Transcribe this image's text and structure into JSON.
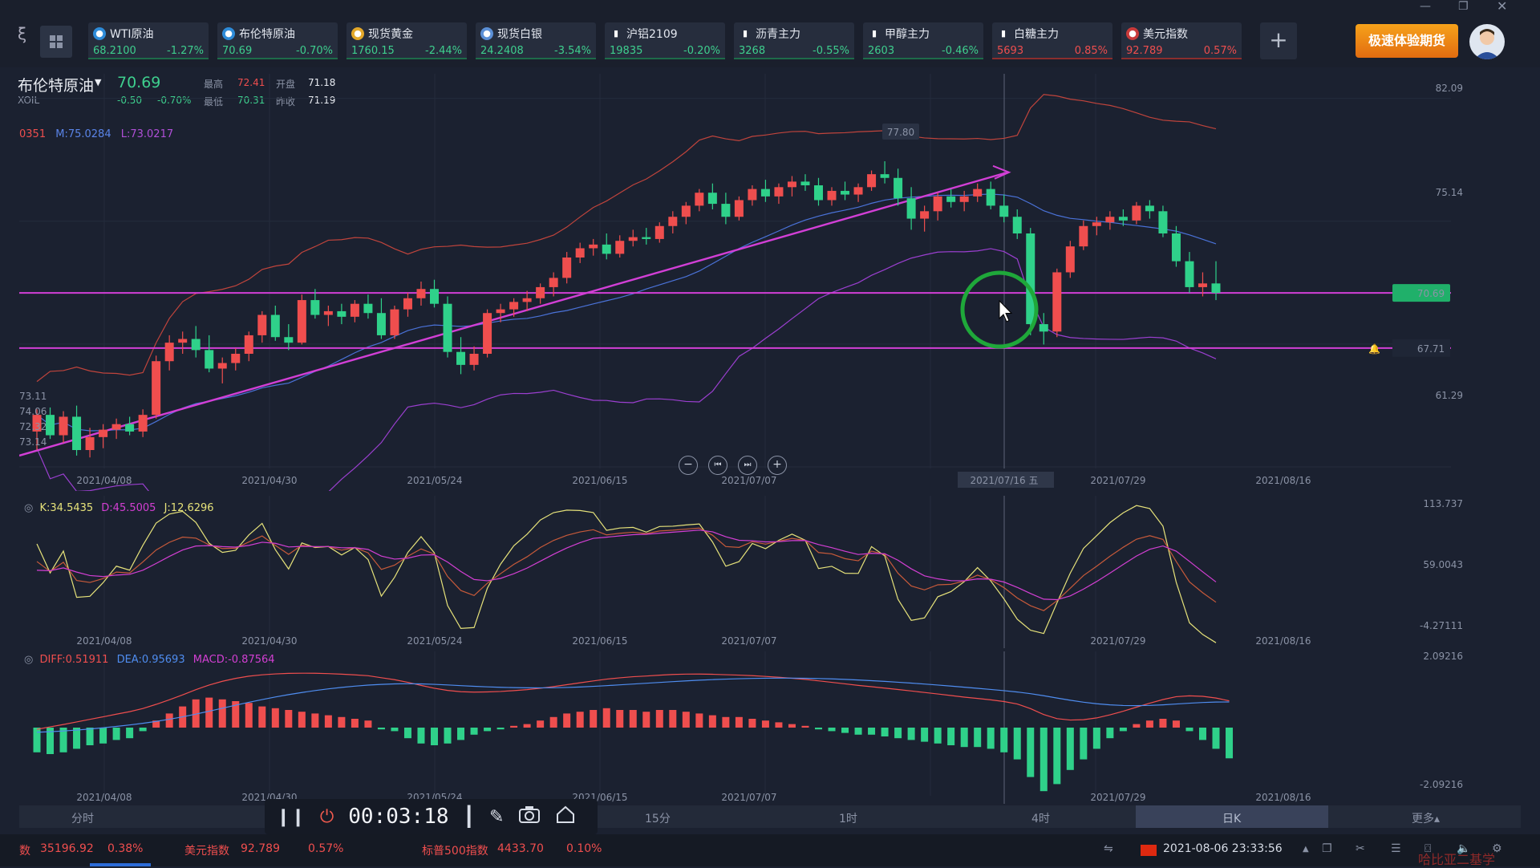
{
  "tickers": [
    {
      "name": "WTI原油",
      "price": "68.2100",
      "change": "-1.27%",
      "dir": "down",
      "icon": "oil-icon"
    },
    {
      "name": "布伦特原油",
      "price": "70.69",
      "change": "-0.70%",
      "dir": "down",
      "icon": "oil-icon"
    },
    {
      "name": "现货黄金",
      "price": "1760.15",
      "change": "-2.44%",
      "dir": "down",
      "icon": "gold-icon"
    },
    {
      "name": "现货白银",
      "price": "24.2408",
      "change": "-3.54%",
      "dir": "down",
      "icon": "silver-icon"
    },
    {
      "name": "沪铝2109",
      "price": "19835",
      "change": "-0.20%",
      "dir": "down",
      "icon": "bar-chart-icon"
    },
    {
      "name": "沥青主力",
      "price": "3268",
      "change": "-0.55%",
      "dir": "down",
      "icon": "bar-chart-icon"
    },
    {
      "name": "甲醇主力",
      "price": "2603",
      "change": "-0.46%",
      "dir": "down",
      "icon": "bar-chart-icon"
    },
    {
      "name": "白糖主力",
      "price": "5693",
      "change": "0.85%",
      "dir": "up",
      "icon": "bar-chart-icon"
    },
    {
      "name": "美元指数",
      "price": "92.789",
      "change": "0.57%",
      "dir": "up",
      "icon": "us-flag-icon"
    }
  ],
  "promo_label": "极速体验期货",
  "instrument": {
    "name": "布伦特原油",
    "code": "XOIL",
    "price": "70.69",
    "change": "-0.50",
    "change_pct": "-0.70%",
    "high_label": "最高",
    "high": "72.41",
    "open_label": "开盘",
    "open": "71.18",
    "low_label": "最低",
    "low": "70.31",
    "prev_label": "昨收",
    "prev": "71.19"
  },
  "boll_text": {
    "up": "0351",
    "mid": "M:75.0284",
    "low": "L:73.0217"
  },
  "left_values": [
    "73.11",
    "74.06",
    "72.32",
    "73.14"
  ],
  "price_axis": [
    "82.09",
    "75.14",
    "67.71",
    "61.29"
  ],
  "price_tags": {
    "current": "70.69",
    "line": "67.71",
    "peak": "77.80"
  },
  "main_dates": [
    "2021/04/08",
    "2021/04/30",
    "2021/05/24",
    "2021/06/15",
    "2021/07/07",
    "2021/07/16 五",
    "2021/07/29",
    "2021/08/16"
  ],
  "sub_dates": [
    "2021/04/08",
    "2021/04/30",
    "2021/05/24",
    "2021/06/15",
    "2021/07/07",
    "2021/07/29",
    "2021/08/16"
  ],
  "kdj": {
    "k": "K:34.5435",
    "d": "D:45.5005",
    "j": "J:12.6296",
    "axis": [
      "113.737",
      "59.0043",
      "-4.27111"
    ]
  },
  "macd_ind": {
    "diff": "DIFF:0.51911",
    "dea": "DEA:0.95693",
    "macd": "MACD:-0.87564",
    "axis": [
      "2.09216",
      "-2.09216"
    ]
  },
  "timeframes": [
    "分时",
    "15分",
    "1时",
    "4时",
    "日K",
    "更多▴"
  ],
  "player": {
    "timer": "00:03:18"
  },
  "status": {
    "index1_name": "数",
    "index1_val": "35196.92",
    "index1_chg": "0.38%",
    "index2_name": "美元指数",
    "index2_val": "92.789",
    "index2_chg": "0.57%",
    "index3_name": "标普500指数",
    "index3_val": "4433.70",
    "index3_chg": "0.10%",
    "datetime": "2021-08-06 23:33:56",
    "watermark": "哈比亚二基学"
  },
  "chart_data": {
    "type": "candlestick",
    "title": "布伦特原油",
    "x_start": "2021/04/08",
    "x_end": "2021/08/06",
    "ylim": [
      61.29,
      82.09
    ],
    "candles": [
      [
        63.2,
        64.4,
        62.2,
        64.1
      ],
      [
        64.1,
        64.5,
        62.8,
        63.0
      ],
      [
        63.0,
        64.3,
        62.6,
        64.0
      ],
      [
        64.0,
        64.6,
        61.9,
        62.2
      ],
      [
        62.2,
        63.4,
        61.8,
        62.9
      ],
      [
        62.9,
        63.6,
        62.3,
        63.3
      ],
      [
        63.3,
        63.9,
        62.8,
        63.6
      ],
      [
        63.6,
        64.0,
        63.0,
        63.2
      ],
      [
        63.2,
        64.4,
        62.9,
        64.1
      ],
      [
        64.1,
        67.3,
        63.9,
        67.0
      ],
      [
        67.0,
        68.4,
        66.5,
        68.0
      ],
      [
        68.0,
        68.6,
        67.4,
        68.2
      ],
      [
        68.2,
        68.9,
        67.2,
        67.6
      ],
      [
        67.6,
        68.4,
        66.4,
        66.6
      ],
      [
        66.6,
        67.2,
        65.8,
        66.9
      ],
      [
        66.9,
        67.7,
        66.5,
        67.4
      ],
      [
        67.4,
        68.6,
        67.0,
        68.4
      ],
      [
        68.4,
        69.7,
        68.0,
        69.5
      ],
      [
        69.5,
        70.0,
        68.1,
        68.3
      ],
      [
        68.3,
        69.0,
        67.6,
        68.0
      ],
      [
        68.0,
        70.6,
        67.9,
        70.3
      ],
      [
        70.3,
        70.9,
        69.3,
        69.5
      ],
      [
        69.5,
        70.0,
        68.9,
        69.7
      ],
      [
        69.7,
        70.1,
        69.0,
        69.4
      ],
      [
        69.4,
        70.3,
        69.1,
        70.1
      ],
      [
        70.1,
        70.6,
        69.3,
        69.6
      ],
      [
        69.6,
        70.4,
        68.2,
        68.4
      ],
      [
        68.4,
        70.0,
        68.2,
        69.8
      ],
      [
        69.8,
        70.7,
        69.4,
        70.4
      ],
      [
        70.4,
        71.3,
        70.0,
        70.9
      ],
      [
        70.9,
        71.4,
        69.9,
        70.1
      ],
      [
        70.1,
        70.5,
        67.2,
        67.5
      ],
      [
        67.5,
        68.3,
        66.3,
        66.8
      ],
      [
        66.8,
        67.8,
        66.5,
        67.4
      ],
      [
        67.4,
        69.8,
        67.2,
        69.6
      ],
      [
        69.6,
        70.1,
        69.1,
        69.8
      ],
      [
        69.8,
        70.4,
        69.4,
        70.2
      ],
      [
        70.2,
        70.8,
        69.7,
        70.4
      ],
      [
        70.4,
        71.2,
        70.1,
        71.0
      ],
      [
        71.0,
        71.8,
        70.5,
        71.5
      ],
      [
        71.5,
        72.9,
        71.2,
        72.6
      ],
      [
        72.6,
        73.4,
        72.3,
        73.1
      ],
      [
        73.1,
        73.6,
        72.7,
        73.3
      ],
      [
        73.3,
        73.9,
        72.5,
        72.8
      ],
      [
        72.8,
        73.8,
        72.6,
        73.5
      ],
      [
        73.5,
        74.1,
        73.2,
        73.7
      ],
      [
        73.7,
        74.2,
        73.3,
        73.6
      ],
      [
        73.6,
        74.5,
        73.4,
        74.3
      ],
      [
        74.3,
        75.1,
        73.9,
        74.8
      ],
      [
        74.8,
        75.6,
        74.4,
        75.4
      ],
      [
        75.4,
        76.3,
        75.1,
        76.1
      ],
      [
        76.1,
        76.6,
        75.2,
        75.5
      ],
      [
        75.5,
        76.1,
        74.4,
        74.8
      ],
      [
        74.8,
        75.9,
        74.6,
        75.7
      ],
      [
        75.7,
        76.5,
        75.4,
        76.3
      ],
      [
        76.3,
        76.8,
        75.6,
        75.9
      ],
      [
        75.9,
        76.6,
        75.5,
        76.4
      ],
      [
        76.4,
        77.0,
        75.9,
        76.7
      ],
      [
        76.7,
        77.1,
        76.2,
        76.5
      ],
      [
        76.5,
        76.9,
        75.4,
        75.7
      ],
      [
        75.7,
        76.4,
        75.4,
        76.2
      ],
      [
        76.2,
        76.7,
        75.7,
        76.0
      ],
      [
        76.0,
        76.6,
        75.6,
        76.4
      ],
      [
        76.4,
        77.3,
        76.2,
        77.1
      ],
      [
        77.1,
        77.8,
        76.6,
        76.9
      ],
      [
        76.9,
        77.4,
        75.4,
        75.8
      ],
      [
        75.8,
        76.4,
        74.1,
        74.7
      ],
      [
        74.7,
        75.4,
        74.0,
        75.1
      ],
      [
        75.1,
        76.1,
        74.6,
        75.9
      ],
      [
        75.9,
        76.3,
        75.3,
        75.6
      ],
      [
        75.6,
        76.2,
        75.1,
        75.9
      ],
      [
        75.9,
        76.6,
        75.6,
        76.3
      ],
      [
        76.3,
        76.7,
        75.2,
        75.4
      ],
      [
        75.4,
        76.0,
        74.5,
        74.8
      ],
      [
        74.8,
        75.2,
        73.6,
        73.9
      ],
      [
        73.9,
        74.2,
        68.4,
        69.0
      ],
      [
        69.0,
        69.6,
        67.9,
        68.6
      ],
      [
        68.6,
        72.0,
        68.3,
        71.8
      ],
      [
        71.8,
        73.5,
        71.5,
        73.2
      ],
      [
        73.2,
        74.6,
        73.0,
        74.3
      ],
      [
        74.3,
        74.8,
        73.8,
        74.5
      ],
      [
        74.5,
        75.1,
        74.1,
        74.8
      ],
      [
        74.8,
        75.2,
        74.3,
        74.6
      ],
      [
        74.6,
        75.6,
        74.4,
        75.4
      ],
      [
        75.4,
        75.7,
        74.7,
        75.1
      ],
      [
        75.1,
        75.4,
        73.7,
        73.9
      ],
      [
        73.9,
        74.3,
        72.1,
        72.4
      ],
      [
        72.4,
        72.9,
        70.7,
        71.0
      ],
      [
        71.0,
        71.8,
        70.5,
        71.2
      ],
      [
        71.2,
        72.4,
        70.3,
        70.69
      ]
    ],
    "horizontal_lines": [
      70.69,
      67.71
    ],
    "boll_upper_end": 78.5,
    "macd_hist": [
      -0.7,
      -0.75,
      -0.7,
      -0.6,
      -0.5,
      -0.45,
      -0.35,
      -0.3,
      -0.1,
      0.2,
      0.4,
      0.6,
      0.8,
      0.85,
      0.8,
      0.75,
      0.7,
      0.6,
      0.55,
      0.5,
      0.45,
      0.4,
      0.35,
      0.3,
      0.25,
      0.2,
      -0.05,
      -0.1,
      -0.3,
      -0.45,
      -0.5,
      -0.45,
      -0.35,
      -0.2,
      -0.1,
      -0.05,
      0.05,
      0.1,
      0.2,
      0.3,
      0.4,
      0.45,
      0.5,
      0.55,
      0.5,
      0.5,
      0.45,
      0.5,
      0.5,
      0.45,
      0.4,
      0.35,
      0.3,
      0.3,
      0.25,
      0.2,
      0.15,
      0.1,
      0.05,
      -0.05,
      -0.1,
      -0.15,
      -0.2,
      -0.2,
      -0.25,
      -0.3,
      -0.35,
      -0.4,
      -0.45,
      -0.5,
      -0.55,
      -0.55,
      -0.6,
      -0.7,
      -0.9,
      -1.4,
      -1.8,
      -1.6,
      -1.2,
      -0.9,
      -0.6,
      -0.3,
      -0.1,
      0.1,
      0.2,
      0.25,
      0.2,
      -0.1,
      -0.35,
      -0.6,
      -0.87
    ]
  }
}
